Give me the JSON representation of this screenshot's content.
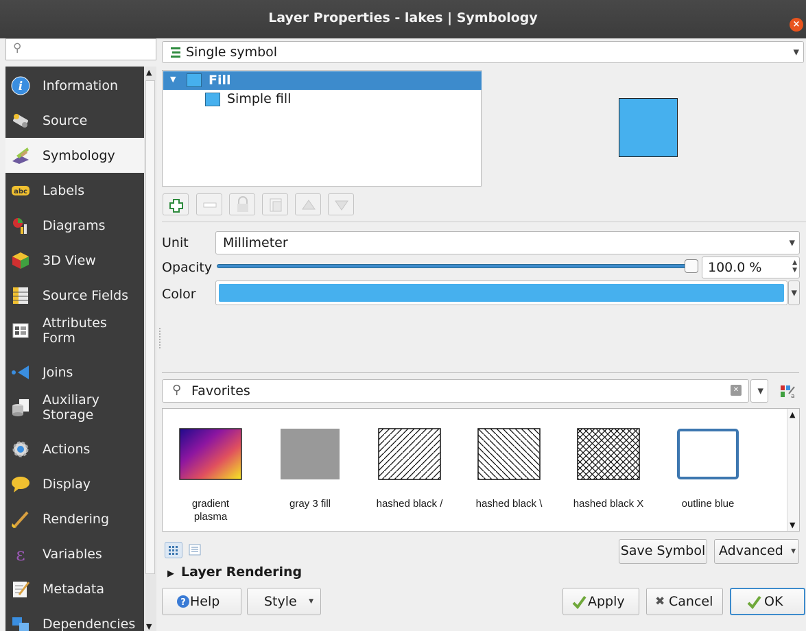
{
  "window": {
    "title": "Layer Properties - lakes | Symbology",
    "close_glyph": "×"
  },
  "sidebar": {
    "search_placeholder": "",
    "items": [
      {
        "label": "Information",
        "icon": "info-icon"
      },
      {
        "label": "Source",
        "icon": "source-icon"
      },
      {
        "label": "Symbology",
        "icon": "symbology-icon",
        "active": true
      },
      {
        "label": "Labels",
        "icon": "labels-icon"
      },
      {
        "label": "Diagrams",
        "icon": "diagrams-icon"
      },
      {
        "label": "3D View",
        "icon": "3d-view-icon"
      },
      {
        "label": "Source Fields",
        "icon": "source-fields-icon"
      },
      {
        "label": "Attributes\nForm",
        "icon": "attributes-form-icon"
      },
      {
        "label": "Joins",
        "icon": "joins-icon"
      },
      {
        "label": "Auxiliary\nStorage",
        "icon": "auxiliary-storage-icon"
      },
      {
        "label": "Actions",
        "icon": "actions-icon"
      },
      {
        "label": "Display",
        "icon": "display-icon"
      },
      {
        "label": "Rendering",
        "icon": "rendering-icon"
      },
      {
        "label": "Variables",
        "icon": "variables-icon"
      },
      {
        "label": "Metadata",
        "icon": "metadata-icon"
      },
      {
        "label": "Dependencies",
        "icon": "dependencies-icon"
      }
    ],
    "abc_text": "abc",
    "epsilon_glyph": "ε"
  },
  "renderer": {
    "selected": "Single symbol"
  },
  "symbol_tree": {
    "root": "Fill",
    "child": "Simple fill"
  },
  "properties": {
    "unit_label": "Unit",
    "unit_value": "Millimeter",
    "opacity_label": "Opacity",
    "opacity_value": "100.0 %",
    "opacity_level": 1.0,
    "color_label": "Color",
    "color_value": "#46b0ee"
  },
  "library": {
    "filter": "Favorites",
    "symbols": [
      {
        "name": "gradient\nplasma"
      },
      {
        "name": "gray 3 fill"
      },
      {
        "name": "hashed black /"
      },
      {
        "name": "hashed black \\"
      },
      {
        "name": "hashed black X"
      },
      {
        "name": "outline blue"
      }
    ],
    "save_symbol": "Save Symbol",
    "advanced": "Advanced"
  },
  "layer_rendering": "Layer Rendering",
  "footer": {
    "help": "Help",
    "style": "Style",
    "apply": "Apply",
    "cancel": "Cancel",
    "ok": "OK"
  },
  "colors": {
    "selection": "#3d8bcc",
    "fill": "#46b0ee",
    "sidebar_bg": "#3c3c3c"
  }
}
